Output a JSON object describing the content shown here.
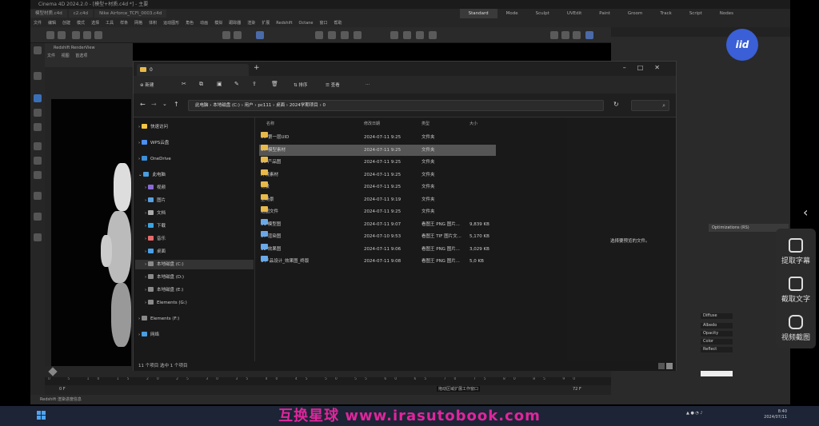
{
  "c4d": {
    "title": "Cinema 4D 2024.2.0 - [模型+材质.c4d *] - 主要",
    "file_tabs": [
      "模型材质.c4d",
      "c2.c4d",
      "Nike Airforce_TCFI_0003.c4d"
    ],
    "layout_tabs": [
      "Standard",
      "Mode",
      "Sculpt",
      "UVEdit",
      "Paint",
      "Groom",
      "Track",
      "Script",
      "Nodes"
    ],
    "active_layout_tab": "Standard",
    "menu": [
      "文件",
      "编辑",
      "创建",
      "模式",
      "选择",
      "工具",
      "样条",
      "网格",
      "体积",
      "运动图形",
      "角色",
      "动画",
      "模拟",
      "跟踪器",
      "渲染",
      "扩展",
      "Redshift",
      "Octane",
      "窗口",
      "帮助"
    ],
    "viewport_label": "Redshift RenderView",
    "viewport_menu": [
      "文件",
      "视图",
      "首选项"
    ],
    "attr_tab": "Optimizations (RS)",
    "attr_rows": [
      "Diffuse",
      "Albedo",
      "Opacity",
      "Color",
      "Reflect"
    ],
    "timeline_ticks": [
      "0",
      "5",
      "10",
      "15",
      "20",
      "25",
      "30",
      "35",
      "40",
      "45",
      "50",
      "55",
      "60",
      "65",
      "70",
      "75",
      "80",
      "85",
      "90"
    ],
    "frame_start": "0 F",
    "frame_end": "72 F",
    "status": "Redshift 渲染进度信息",
    "tooltip": "拖动区域扩展工作窗口"
  },
  "explorer": {
    "tab_title": "0",
    "cmd": {
      "new": "新建",
      "sort": "排序",
      "view": "查看",
      "more": "..."
    },
    "path": [
      "此电脑",
      "本地磁盘 (C:)",
      "用户",
      "pc111",
      "桌面",
      "2024学期项目",
      "0"
    ],
    "columns": {
      "name": "名称",
      "date": "修改日期",
      "type": "类型",
      "size": "大小"
    },
    "nav": [
      {
        "label": "快速访问",
        "color": "#f4c542"
      },
      {
        "label": "WPS云盘",
        "color": "#4d8ef0"
      },
      {
        "label": "OneDrive",
        "color": "#3b8fd9"
      },
      {
        "label": "此电脑",
        "color": "#4a9de0"
      },
      {
        "label": "视频",
        "color": "#8a6ad8"
      },
      {
        "label": "图片",
        "color": "#5aa0e0"
      },
      {
        "label": "文档",
        "color": "#aaaaaa"
      },
      {
        "label": "下载",
        "color": "#3ba3e0"
      },
      {
        "label": "音乐",
        "color": "#e86a6a"
      },
      {
        "label": "桌面",
        "color": "#4aa0e8"
      },
      {
        "label": "本地磁盘 (C:)",
        "color": "#8a8a8a"
      },
      {
        "label": "本地磁盘 (D:)",
        "color": "#8a8a8a"
      },
      {
        "label": "本地磁盘 (E:)",
        "color": "#8a8a8a"
      },
      {
        "label": "Elements (G:)",
        "color": "#8a8a8a"
      },
      {
        "label": "Elements (F:)",
        "color": "#8a8a8a"
      },
      {
        "label": "网络",
        "color": "#4a9de0"
      }
    ],
    "files": [
      {
        "name": "06-第一层UID",
        "date": "2024-07-11 9:25",
        "type": "文件夹",
        "size": "",
        "icon": "folder"
      },
      {
        "name": "07-模型素材",
        "date": "2024-07-11 9:25",
        "type": "文件夹",
        "size": "",
        "icon": "folder"
      },
      {
        "name": "10 产品图",
        "date": "2024-07-11 9:25",
        "type": "文件夹",
        "size": "",
        "icon": "folder"
      },
      {
        "name": "环境素材",
        "date": "2024-07-11 9:25",
        "type": "文件夹",
        "size": "",
        "icon": "folder"
      },
      {
        "name": "背景",
        "date": "2024-07-11 9:25",
        "type": "文件夹",
        "size": "",
        "icon": "folder"
      },
      {
        "name": "主场景",
        "date": "2024-07-11 9:19",
        "type": "文件夹",
        "size": "",
        "icon": "folder"
      },
      {
        "name": "贴图文件",
        "date": "2024-07-11 9:25",
        "type": "文件夹",
        "size": "",
        "icon": "folder"
      },
      {
        "name": "01 模型图",
        "date": "2024-07-11 9:07",
        "type": "看图王 PNG 图片...",
        "size": "9,839 KB",
        "icon": "image"
      },
      {
        "name": "07 渲染图",
        "date": "2024-07-10 9:53",
        "type": "看图王 TIF 图片文...",
        "size": "5,170 KB",
        "icon": "image"
      },
      {
        "name": "12 效果图",
        "date": "2024-07-11 9:06",
        "type": "看图王 PNG 图片...",
        "size": "3,029 KB",
        "icon": "image"
      },
      {
        "name": "1 产品设计_效果图_终版",
        "date": "2024-07-11 9:08",
        "type": "看图王 PNG 图片...",
        "size": "5,0 KB",
        "icon": "image"
      }
    ],
    "preview_text": "选择要预览的文件。",
    "status": "11 个项目    选中 1 个项目"
  },
  "overlay": {
    "logo": "iid",
    "side_tools": [
      "提取字幕",
      "截取文字",
      "视频截图"
    ],
    "banner": "互换星球 www.irasutobook.com",
    "clock_time": "8:40",
    "clock_date": "2024/07/11"
  },
  "colors": {
    "folder": "#e8b94a",
    "image": "#6aa9e8",
    "accent": "#3a5fd6",
    "banner": "#e0259c",
    "highlight": "#555555"
  }
}
